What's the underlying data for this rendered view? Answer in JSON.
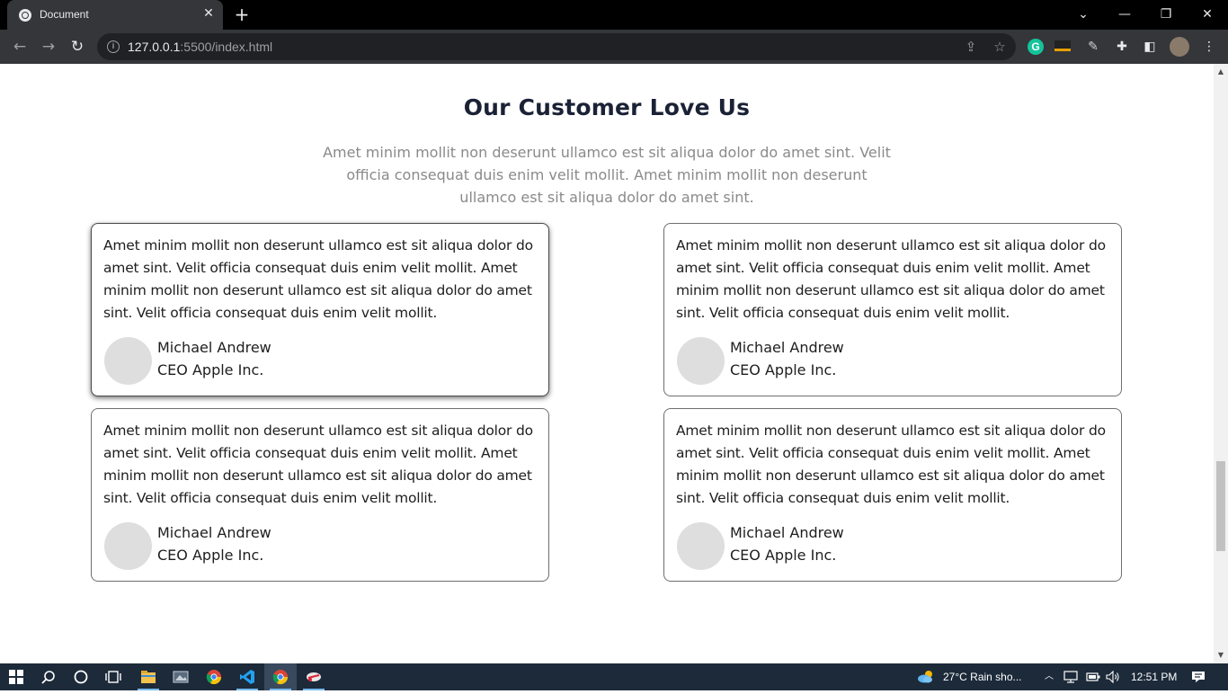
{
  "browser": {
    "tab_title": "Document",
    "url_host": "127.0.0.1",
    "url_path": ":5500/index.html",
    "new_tab": "+",
    "close_tab": "✕",
    "back": "←",
    "forward": "→",
    "reload": "↻",
    "minimize": "—",
    "restore": "❐",
    "close": "✕",
    "tab_search": "⌄",
    "info": "i",
    "share": "⇪",
    "bookmark": "☆",
    "grammarly": "G",
    "extensions": "✚",
    "sidepanel": "◧",
    "menu": "⋮"
  },
  "section": {
    "title": "Our Customer Love Us",
    "subtitle": "Amet minim mollit non deserunt ullamco est sit aliqua dolor do amet sint. Velit officia consequat duis enim velit mollit. Amet minim mollit non deserunt ullamco est sit aliqua dolor do amet sint."
  },
  "testimonials": [
    {
      "text": "Amet minim mollit non deserunt ullamco est sit aliqua dolor do amet sint. Velit officia consequat duis enim velit mollit. Amet minim mollit non deserunt ullamco est sit aliqua dolor do amet sint. Velit officia consequat duis enim velit mollit.",
      "name": "Michael Andrew",
      "role": "CEO Apple Inc."
    },
    {
      "text": "Amet minim mollit non deserunt ullamco est sit aliqua dolor do amet sint. Velit officia consequat duis enim velit mollit. Amet minim mollit non deserunt ullamco est sit aliqua dolor do amet sint. Velit officia consequat duis enim velit mollit.",
      "name": "Michael Andrew",
      "role": "CEO Apple Inc."
    },
    {
      "text": "Amet minim mollit non deserunt ullamco est sit aliqua dolor do amet sint. Velit officia consequat duis enim velit mollit. Amet minim mollit non deserunt ullamco est sit aliqua dolor do amet sint. Velit officia consequat duis enim velit mollit.",
      "name": "Michael Andrew",
      "role": "CEO Apple Inc."
    },
    {
      "text": "Amet minim mollit non deserunt ullamco est sit aliqua dolor do amet sint. Velit officia consequat duis enim velit mollit. Amet minim mollit non deserunt ullamco est sit aliqua dolor do amet sint. Velit officia consequat duis enim velit mollit.",
      "name": "Michael Andrew",
      "role": "CEO Apple Inc."
    }
  ],
  "taskbar": {
    "weather": "27°C  Rain sho...",
    "time": "12:51 PM"
  },
  "colors": {
    "title": "#1b2236",
    "subtitle": "#8a8a8a",
    "avatar": "#dedede",
    "taskbar": "#1c2a3a"
  }
}
